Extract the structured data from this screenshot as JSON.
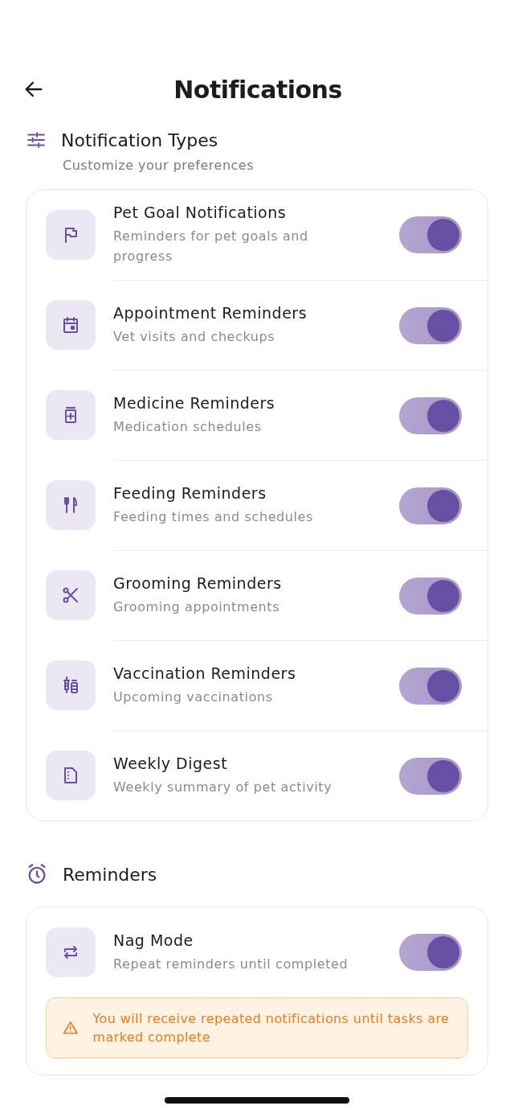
{
  "header": {
    "title": "Notifications"
  },
  "sections": [
    {
      "title": "Notification Types",
      "subtitle": "Customize your preferences",
      "items": [
        {
          "title": "Pet Goal Notifications",
          "description": "Reminders for pet goals and progress",
          "on": true
        },
        {
          "title": "Appointment Reminders",
          "description": "Vet visits and checkups",
          "on": true
        },
        {
          "title": "Medicine Reminders",
          "description": "Medication schedules",
          "on": true
        },
        {
          "title": "Feeding Reminders",
          "description": "Feeding times and schedules",
          "on": true
        },
        {
          "title": "Grooming Reminders",
          "description": "Grooming appointments",
          "on": true
        },
        {
          "title": "Vaccination Reminders",
          "description": "Upcoming vaccinations",
          "on": true
        },
        {
          "title": "Weekly Digest",
          "description": "Weekly summary of pet activity",
          "on": true
        }
      ]
    },
    {
      "title": "Reminders",
      "items": [
        {
          "title": "Nag Mode",
          "description": "Repeat reminders until completed",
          "on": true
        }
      ],
      "warning": "You will receive repeated notifications until tasks are marked complete"
    }
  ]
}
